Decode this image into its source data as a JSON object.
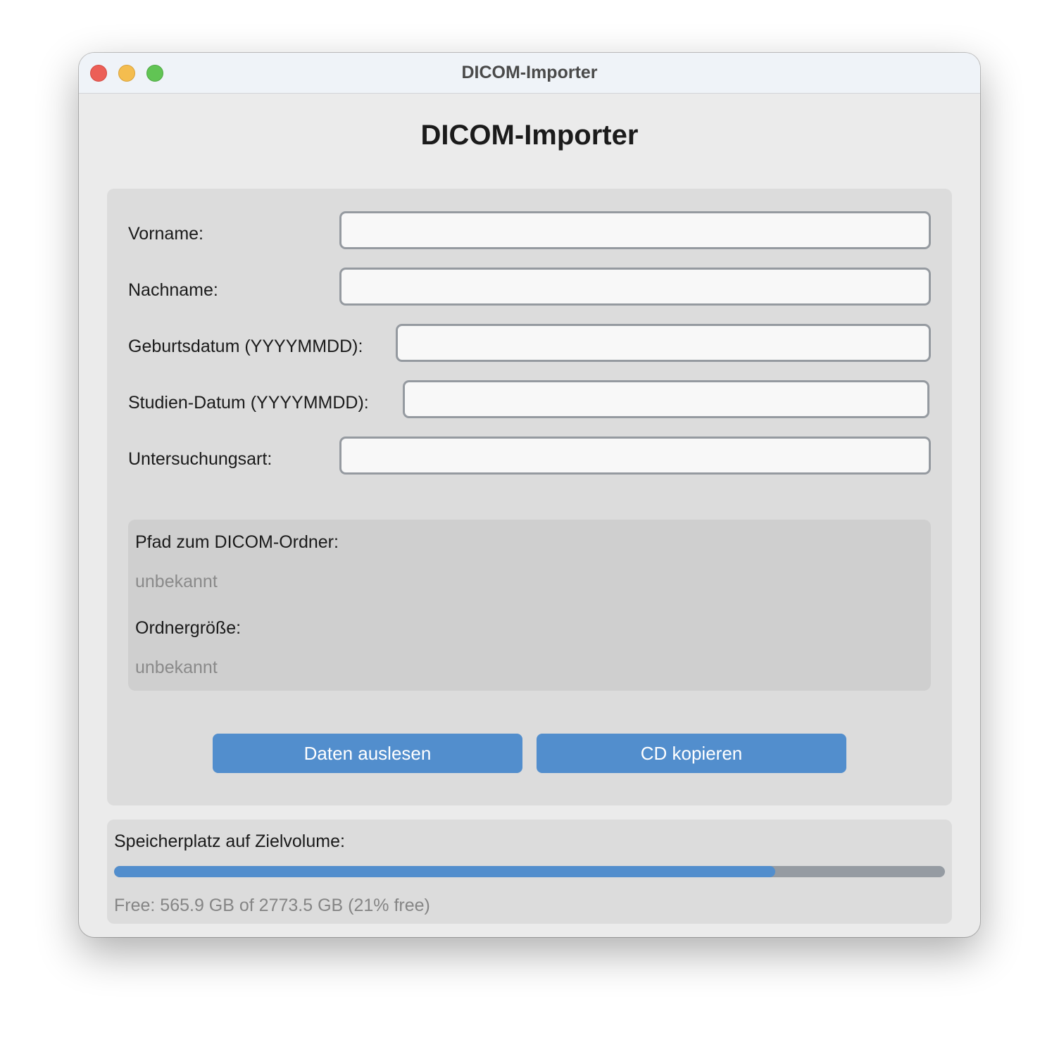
{
  "window": {
    "title": "DICOM-Importer"
  },
  "app": {
    "heading": "DICOM-Importer"
  },
  "form": {
    "fields": [
      {
        "label": "Vorname:",
        "value": ""
      },
      {
        "label": "Nachname:",
        "value": ""
      },
      {
        "label": "Geburtsdatum (YYYYMMDD):",
        "value": ""
      },
      {
        "label": "Studien-Datum (YYYYMMDD):",
        "value": ""
      },
      {
        "label": "Untersuchungsart:",
        "value": ""
      }
    ]
  },
  "info": {
    "path_label": "Pfad zum DICOM-Ordner:",
    "path_value": "unbekannt",
    "size_label": "Ordnergröße:",
    "size_value": "unbekannt"
  },
  "actions": {
    "read_label": "Daten auslesen",
    "copy_label": "CD kopieren"
  },
  "storage": {
    "label": "Speicherplatz auf Zielvolume:",
    "used_fraction": 0.7959,
    "summary": "Free: 565.9 GB of 2773.5 GB (21% free)"
  },
  "colors": {
    "accent": "#528ecd",
    "window_bg": "#ebebeb",
    "panel_bg": "#dcdcdc",
    "info_bg": "#cfcfcf",
    "close": "#ec5f57",
    "minimize": "#f4bd4f",
    "maximize": "#61c454"
  }
}
